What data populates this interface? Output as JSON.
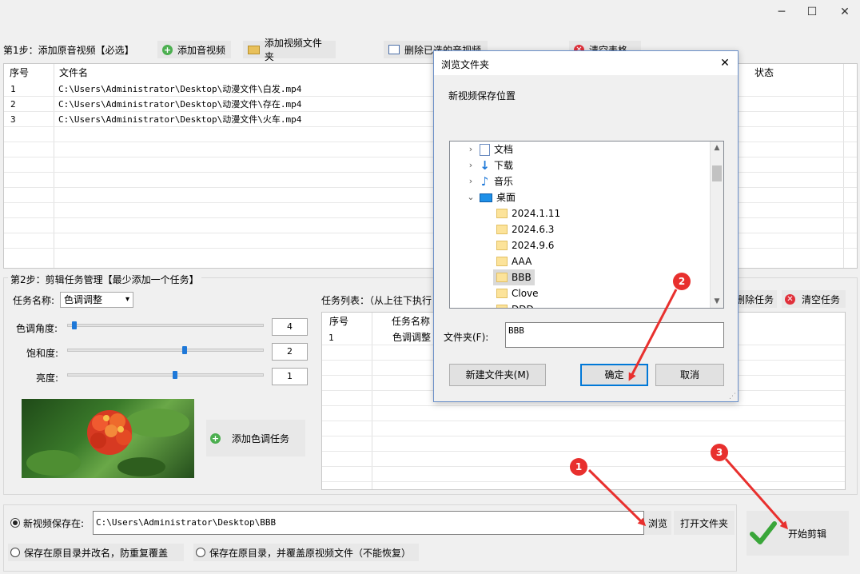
{
  "window": {
    "minimize": "─",
    "maximize": "☐",
    "close": "✕"
  },
  "toolbar": {
    "step1_label": "第1步：添加原音视频【必选】",
    "add_audio": "添加音视频",
    "add_video_folder": "添加视频文件夹",
    "delete_selected": "删除已选的音视频",
    "clear_table": "清空表格"
  },
  "file_table": {
    "headers": {
      "index": "序号",
      "filename": "文件名",
      "status": "状态"
    },
    "rows": [
      {
        "index": "1",
        "filename": "C:\\Users\\Administrator\\Desktop\\动漫文件\\白发.mp4"
      },
      {
        "index": "2",
        "filename": "C:\\Users\\Administrator\\Desktop\\动漫文件\\存在.mp4"
      },
      {
        "index": "3",
        "filename": "C:\\Users\\Administrator\\Desktop\\动漫文件\\火车.mp4"
      }
    ]
  },
  "step2": {
    "label": "第2步：剪辑任务管理【最少添加一个任务】",
    "task_name_label": "任务名称:",
    "task_name_value": "色调调整",
    "hue_label": "色调角度:",
    "hue_value": "4",
    "hue_level": 0.02,
    "saturation_label": "饱和度:",
    "saturation_value": "2",
    "saturation_level": 0.6,
    "brightness_label": "亮度:",
    "brightness_value": "1",
    "brightness_level": 0.55,
    "add_tone_task": "添加色调任务",
    "task_list_label": "任务列表：（从上往下执行",
    "delete_task": "删除任务",
    "clear_tasks": "清空任务",
    "task_headers": {
      "index": "序号",
      "name": "任务名称"
    },
    "tasks": [
      {
        "index": "1",
        "name": "色调调整"
      }
    ]
  },
  "output": {
    "new_save_label": "新视频保存在:",
    "path": "C:\\Users\\Administrator\\Desktop\\BBB",
    "browse": "浏览",
    "open_folder": "打开文件夹",
    "option_rename": "保存在原目录并改名，防重复覆盖",
    "option_overwrite": "保存在原目录，并覆盖原视频文件（不能恢复）",
    "start": "开始剪辑"
  },
  "dialog": {
    "title": "浏览文件夹",
    "description": "新视频保存位置",
    "tree": [
      {
        "label": "文档",
        "icon": "document-icon",
        "level": 1,
        "chevron": "›"
      },
      {
        "label": "下载",
        "icon": "download-icon",
        "level": 1,
        "chevron": "›"
      },
      {
        "label": "音乐",
        "icon": "music-icon",
        "level": 1,
        "chevron": "›"
      },
      {
        "label": "桌面",
        "icon": "desktop-icon",
        "level": 1,
        "chevron": "⌄"
      },
      {
        "label": "2024.1.11",
        "icon": "folder-icon",
        "level": 2
      },
      {
        "label": "2024.6.3",
        "icon": "folder-icon",
        "level": 2
      },
      {
        "label": "2024.9.6",
        "icon": "folder-icon",
        "level": 2
      },
      {
        "label": "AAA",
        "icon": "folder-icon",
        "level": 2
      },
      {
        "label": "BBB",
        "icon": "folder-icon",
        "level": 2,
        "selected": true
      },
      {
        "label": "Clove",
        "icon": "folder-icon",
        "level": 2
      },
      {
        "label": "DDD",
        "icon": "folder-icon",
        "level": 2
      }
    ],
    "folder_label": "文件夹(F):",
    "folder_value": "BBB",
    "new_folder": "新建文件夹(M)",
    "ok": "确定",
    "cancel": "取消"
  },
  "annotations": {
    "badge1": "1",
    "badge2": "2",
    "badge3": "3"
  },
  "colors": {
    "accent": "#0078d7",
    "annotation": "#e8302e",
    "start_check": "#3aa63a"
  }
}
